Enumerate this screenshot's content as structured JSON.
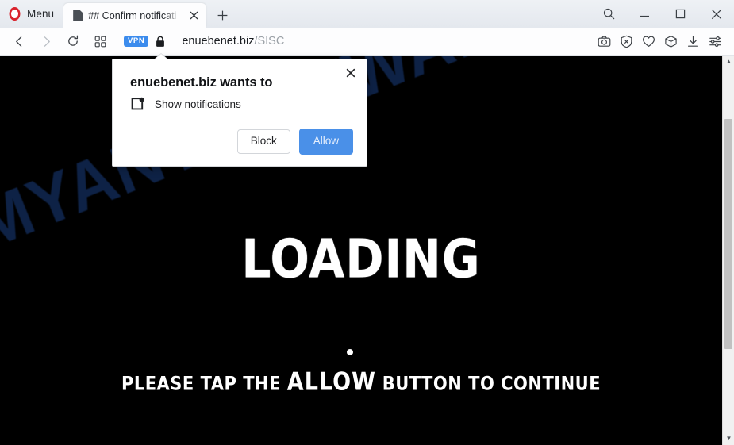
{
  "browser": {
    "menu_label": "Menu",
    "logo_icon": "opera-logo",
    "tab": {
      "title": "## Confirm notificati",
      "favicon_icon": "page-favicon",
      "close_icon": "close-icon"
    },
    "new_tab_label": "+",
    "window_controls": [
      {
        "name": "search-button",
        "icon": "search-icon"
      },
      {
        "name": "minimize-button",
        "icon": "minimize-icon"
      },
      {
        "name": "maximize-button",
        "icon": "maximize-icon"
      },
      {
        "name": "close-window-button",
        "icon": "close-icon"
      }
    ],
    "navigation": [
      {
        "name": "back-button",
        "icon": "chevron-left-icon"
      },
      {
        "name": "forward-button",
        "icon": "chevron-right-icon"
      },
      {
        "name": "reload-button",
        "icon": "reload-icon"
      },
      {
        "name": "tab-overview-button",
        "icon": "grid-icon"
      }
    ],
    "omnibox": {
      "vpn_badge": "VPN",
      "lock_icon": "lock-icon",
      "url_host": "enuebenet.biz",
      "url_path": "/SISC"
    },
    "toolbar_icons": [
      {
        "name": "snapshot-button",
        "icon": "camera-icon"
      },
      {
        "name": "ad-blocker-button",
        "icon": "shield-x-icon"
      },
      {
        "name": "favorites-button",
        "icon": "heart-icon"
      },
      {
        "name": "extensions-button",
        "icon": "cube-icon"
      },
      {
        "name": "downloads-button",
        "icon": "download-icon"
      },
      {
        "name": "easy-setup-button",
        "icon": "sliders-icon"
      }
    ]
  },
  "permission_dialog": {
    "title": "enuebenet.biz wants to",
    "permission": "Show notifications",
    "permission_icon": "notification-icon",
    "close_icon": "close-icon",
    "block_label": "Block",
    "allow_label": "Allow",
    "allow_color": "#4a90e8"
  },
  "page": {
    "background_color": "#000000",
    "loading_text": "LOADING",
    "instruction_prefix": "PLEASE TAP THE",
    "instruction_emphasis": "ALLOW",
    "instruction_suffix": "BUTTON TO CONTINUE",
    "watermark": "MYANTISPYWARE.COM",
    "watermark_color": "#0e2246",
    "spinner_icon": "loading-dot"
  },
  "scrollbar": {
    "up_arrow": "▲",
    "down_arrow": "▼"
  }
}
